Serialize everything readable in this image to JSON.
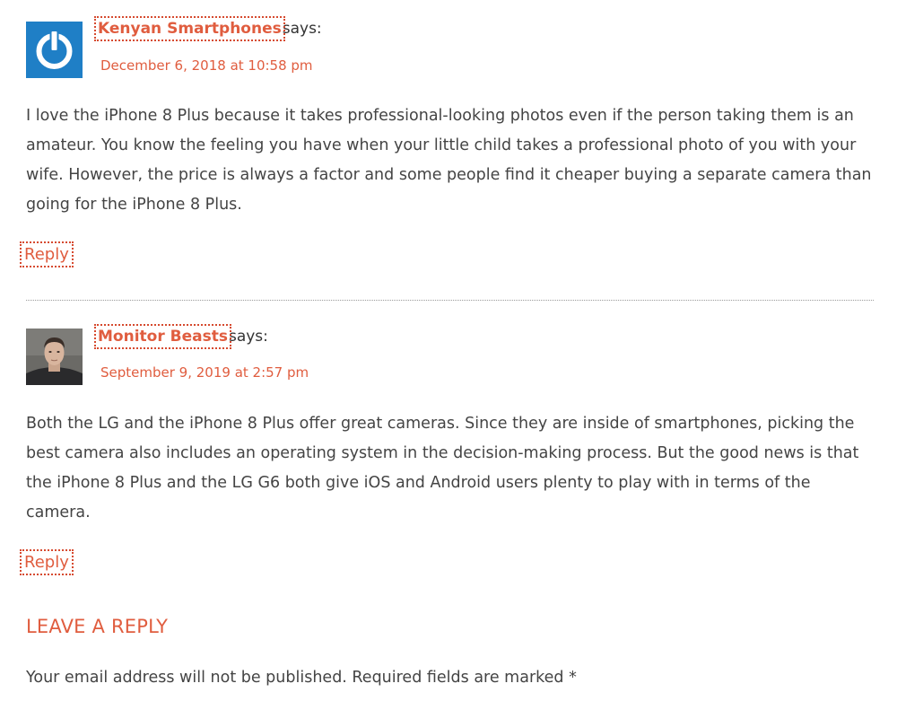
{
  "comments": [
    {
      "author": "Kenyan Smartphones",
      "says": "says:",
      "date": "December 6, 2018 at 10:58 pm",
      "body": "I love the iPhone 8 Plus because it takes professional-looking photos even if the person taking them is an amateur. You know the feeling you have when your little child takes a professional photo of you with your wife. However, the price is always a factor and some people find it cheaper buying a separate camera than going for the iPhone 8 Plus.",
      "reply": "Reply",
      "avatar_icon": "power-icon",
      "avatar_color": "#1f7fc6"
    },
    {
      "author": "Monitor Beasts",
      "says": "says:",
      "date": "September 9, 2019 at 2:57 pm",
      "body": "Both the LG and the iPhone 8 Plus offer great cameras. Since they are inside of smartphones, picking the best camera also includes an operating system in the decision-making process. But the good news is that the iPhone 8 Plus and the LG G6 both give iOS and Android users plenty to play with in terms of the camera.",
      "reply": "Reply",
      "avatar_icon": "person-photo"
    }
  ],
  "leave_reply": {
    "heading": "LEAVE A REPLY",
    "notes": "Your email address will not be published. Required fields are marked *"
  },
  "colors": {
    "accent": "#e05d3f",
    "text": "#444444"
  }
}
